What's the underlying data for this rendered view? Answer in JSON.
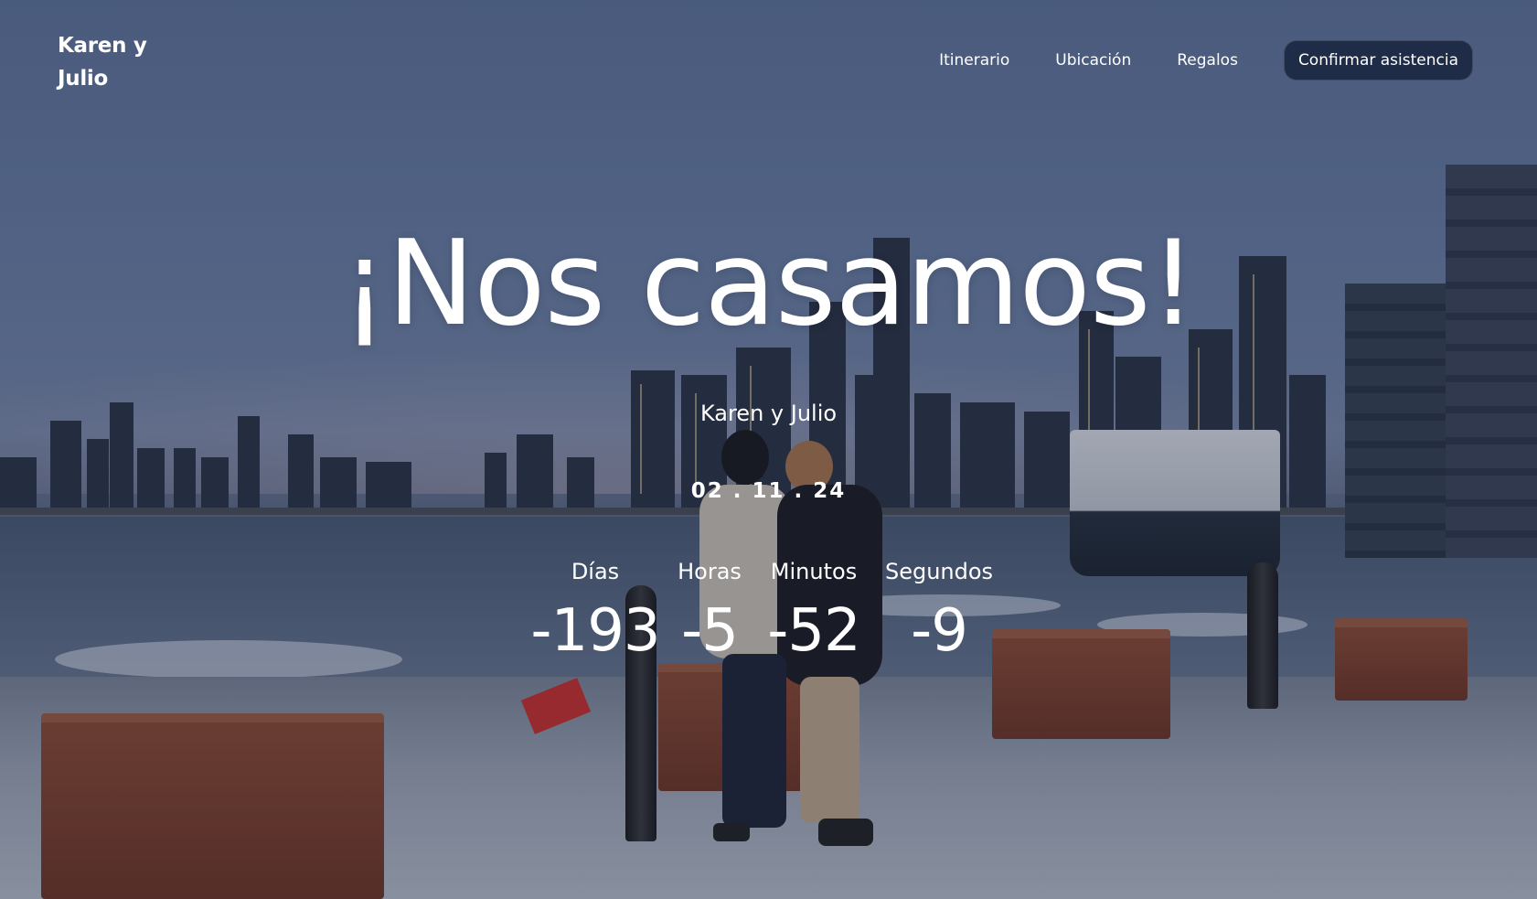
{
  "header": {
    "brand": "Karen y Julio",
    "nav": [
      {
        "label": "Itinerario"
      },
      {
        "label": "Ubicación"
      },
      {
        "label": "Regalos"
      }
    ],
    "cta_label": "Confirmar asistencia"
  },
  "hero": {
    "title": "¡Nos casamos!",
    "couple": "Karen y Julio",
    "date": "02 . 11 . 24",
    "countdown": [
      {
        "label": "Días",
        "value": "-193"
      },
      {
        "label": "Horas",
        "value": "-5"
      },
      {
        "label": "Minutos",
        "value": "-52"
      },
      {
        "label": "Segundos",
        "value": "-9"
      }
    ]
  },
  "colors": {
    "cta_background": "#1f2c47",
    "text": "#ffffff"
  }
}
